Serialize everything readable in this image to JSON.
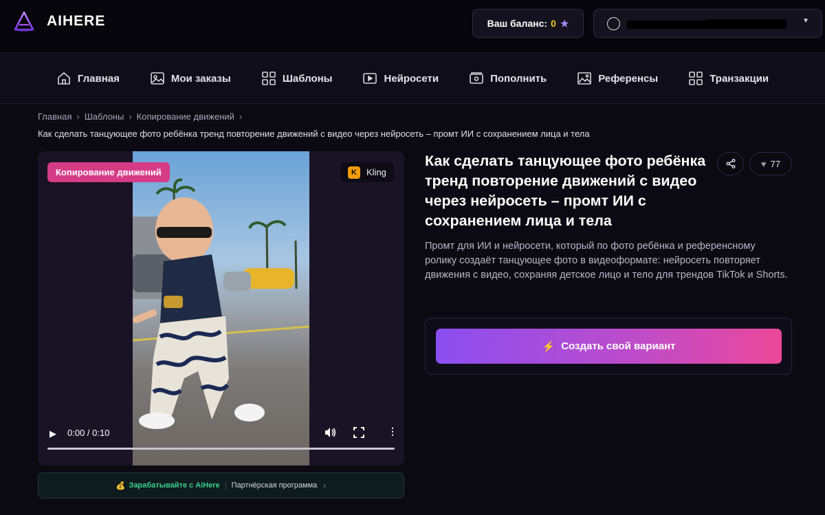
{
  "header": {
    "brand": "AIHERE",
    "balance_label": "Ваш баланс:",
    "balance_value": "0"
  },
  "nav": {
    "items": [
      {
        "label": "Главная",
        "icon": "home-icon"
      },
      {
        "label": "Мои заказы",
        "icon": "image-icon"
      },
      {
        "label": "Шаблоны",
        "icon": "grid-icon"
      },
      {
        "label": "Нейросети",
        "icon": "play-box-icon"
      },
      {
        "label": "Пополнить",
        "icon": "wallet-icon"
      },
      {
        "label": "Референсы",
        "icon": "picture-icon"
      },
      {
        "label": "Транзакции",
        "icon": "grid-icon"
      }
    ]
  },
  "breadcrumb": [
    "Главная",
    "Шаблоны",
    "Копирование движений"
  ],
  "page_heading": "Как сделать танцующее фото ребёнка тренд повторение движений с видео через нейросеть – промт ИИ с сохранением лица и тела",
  "video": {
    "category_tag": "Копирование движений",
    "model_badge": "Kling",
    "model_badge_letter": "K",
    "time": "0:00 / 0:10"
  },
  "partner": {
    "earn": "Зарабатывайте с AiHere",
    "program": "Партнёрская программа"
  },
  "detail": {
    "title": "Как сделать танцующее фото ребёнка тренд повторение движений с видео через нейросеть – промт ИИ с сохранением лица и тела",
    "likes": "77",
    "description": "Промт для ИИ и нейросети, который по фото ребёнка и референсному ролику создаёт танцующее фото в видеоформате: нейросеть повторяет движения с видео, сохраняя детское лицо и тело для трендов TikTok и Shorts.",
    "cta": "Создать свой вариант"
  },
  "colors": {
    "accent_pink": "#d63c86",
    "balance_value": "#f5c518",
    "partner_green": "#3ccf8e"
  }
}
